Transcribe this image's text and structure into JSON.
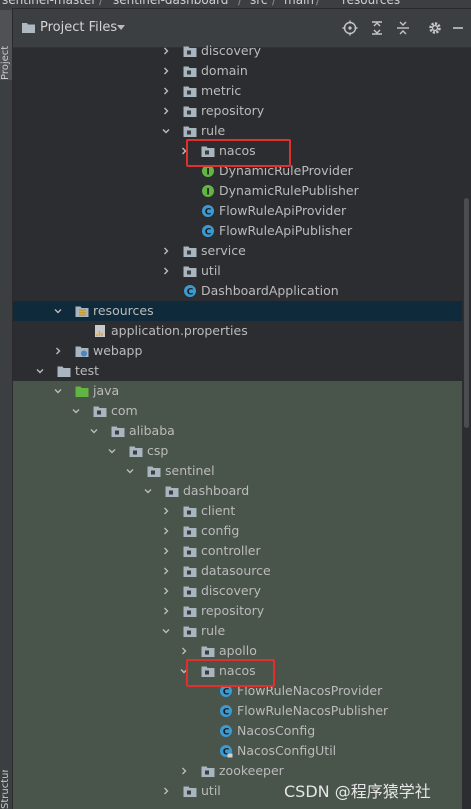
{
  "breadcrumb": [
    "sentinel-master",
    "sentinel-dashboard",
    "src",
    "main",
    "resources"
  ],
  "side_tabs": {
    "project": "Project",
    "structure": "Structure"
  },
  "header": {
    "title": "Project Files"
  },
  "tree": [
    {
      "label": "discovery",
      "kind": "pkg",
      "depth": 9,
      "arrow": "right"
    },
    {
      "label": "domain",
      "kind": "pkg",
      "depth": 9,
      "arrow": "right"
    },
    {
      "label": "metric",
      "kind": "pkg",
      "depth": 9,
      "arrow": "right"
    },
    {
      "label": "repository",
      "kind": "pkg",
      "depth": 9,
      "arrow": "right"
    },
    {
      "label": "rule",
      "kind": "pkg",
      "depth": 9,
      "arrow": "down"
    },
    {
      "label": "nacos",
      "kind": "pkg",
      "depth": 10,
      "arrow": "right",
      "highlight": true
    },
    {
      "label": "DynamicRuleProvider",
      "kind": "interface",
      "depth": 10,
      "arrow": "none"
    },
    {
      "label": "DynamicRulePublisher",
      "kind": "interface",
      "depth": 10,
      "arrow": "none"
    },
    {
      "label": "FlowRuleApiProvider",
      "kind": "class",
      "depth": 10,
      "arrow": "none"
    },
    {
      "label": "FlowRuleApiPublisher",
      "kind": "class",
      "depth": 10,
      "arrow": "none"
    },
    {
      "label": "service",
      "kind": "pkg",
      "depth": 9,
      "arrow": "right"
    },
    {
      "label": "util",
      "kind": "pkg",
      "depth": 9,
      "arrow": "right"
    },
    {
      "label": "DashboardApplication",
      "kind": "class",
      "depth": 9,
      "arrow": "none"
    },
    {
      "label": "resources",
      "kind": "resources",
      "depth": 3,
      "arrow": "down",
      "selected": true
    },
    {
      "label": "application.properties",
      "kind": "properties",
      "depth": 4,
      "arrow": "none"
    },
    {
      "label": "webapp",
      "kind": "webapp",
      "depth": 3,
      "arrow": "right"
    },
    {
      "label": "test",
      "kind": "folder",
      "depth": 2,
      "arrow": "down"
    },
    {
      "label": "java",
      "kind": "testsrc",
      "depth": 3,
      "arrow": "down"
    },
    {
      "label": "com",
      "kind": "pkg",
      "depth": 4,
      "arrow": "down"
    },
    {
      "label": "alibaba",
      "kind": "pkg",
      "depth": 5,
      "arrow": "down"
    },
    {
      "label": "csp",
      "kind": "pkg",
      "depth": 6,
      "arrow": "down"
    },
    {
      "label": "sentinel",
      "kind": "pkg",
      "depth": 7,
      "arrow": "down"
    },
    {
      "label": "dashboard",
      "kind": "pkg",
      "depth": 8,
      "arrow": "down"
    },
    {
      "label": "client",
      "kind": "pkg",
      "depth": 9,
      "arrow": "right"
    },
    {
      "label": "config",
      "kind": "pkg",
      "depth": 9,
      "arrow": "right"
    },
    {
      "label": "controller",
      "kind": "pkg",
      "depth": 9,
      "arrow": "right"
    },
    {
      "label": "datasource",
      "kind": "pkg",
      "depth": 9,
      "arrow": "right"
    },
    {
      "label": "discovery",
      "kind": "pkg",
      "depth": 9,
      "arrow": "right"
    },
    {
      "label": "repository",
      "kind": "pkg",
      "depth": 9,
      "arrow": "right"
    },
    {
      "label": "rule",
      "kind": "pkg",
      "depth": 9,
      "arrow": "down"
    },
    {
      "label": "apollo",
      "kind": "pkg",
      "depth": 10,
      "arrow": "right"
    },
    {
      "label": "nacos",
      "kind": "pkg",
      "depth": 10,
      "arrow": "down",
      "highlight": true
    },
    {
      "label": "FlowRuleNacosProvider",
      "kind": "class",
      "depth": 11,
      "arrow": "none"
    },
    {
      "label": "FlowRuleNacosPublisher",
      "kind": "class",
      "depth": 11,
      "arrow": "none"
    },
    {
      "label": "NacosConfig",
      "kind": "class",
      "depth": 11,
      "arrow": "none"
    },
    {
      "label": "NacosConfigUtil",
      "kind": "class-lock",
      "depth": 11,
      "arrow": "none"
    },
    {
      "label": "zookeeper",
      "kind": "pkg",
      "depth": 10,
      "arrow": "right"
    },
    {
      "label": "util",
      "kind": "pkg",
      "depth": 9,
      "arrow": "right"
    }
  ],
  "watermark": "CSDN @程序猿学社",
  "colors": {
    "highlight_box": "#e0302e",
    "selected_row": "#0f2a3a",
    "test_bg": "#49544a",
    "tree_bg": "#2b2d30"
  }
}
